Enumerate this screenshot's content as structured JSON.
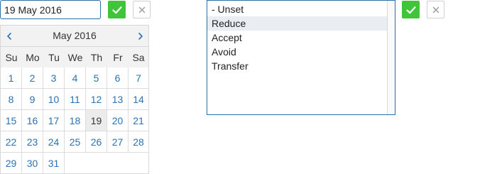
{
  "date_picker": {
    "input_value": "19 May 2016",
    "month_label": "May 2016",
    "weekdays": [
      "Su",
      "Mo",
      "Tu",
      "We",
      "Th",
      "Fr",
      "Sa"
    ],
    "days": [
      "1",
      "2",
      "3",
      "4",
      "5",
      "6",
      "7",
      "8",
      "9",
      "10",
      "11",
      "12",
      "13",
      "14",
      "15",
      "16",
      "17",
      "18",
      "19",
      "20",
      "21",
      "22",
      "23",
      "24",
      "25",
      "26",
      "27",
      "28",
      "29",
      "30",
      "31"
    ],
    "selected_day": "19",
    "confirm_icon": "check-icon",
    "cancel_icon": "close-icon",
    "prev_icon": "chevron-left-icon",
    "next_icon": "chevron-right-icon"
  },
  "list_select": {
    "options": [
      "- Unset",
      "Reduce",
      "Accept",
      "Avoid",
      "Transfer"
    ],
    "selected": "Reduce",
    "confirm_icon": "check-icon",
    "cancel_icon": "close-icon"
  },
  "colors": {
    "accent": "#2a6fa8",
    "confirm": "#3fc43a",
    "link": "#2a72b5",
    "header_bg": "#f2f2f2"
  }
}
